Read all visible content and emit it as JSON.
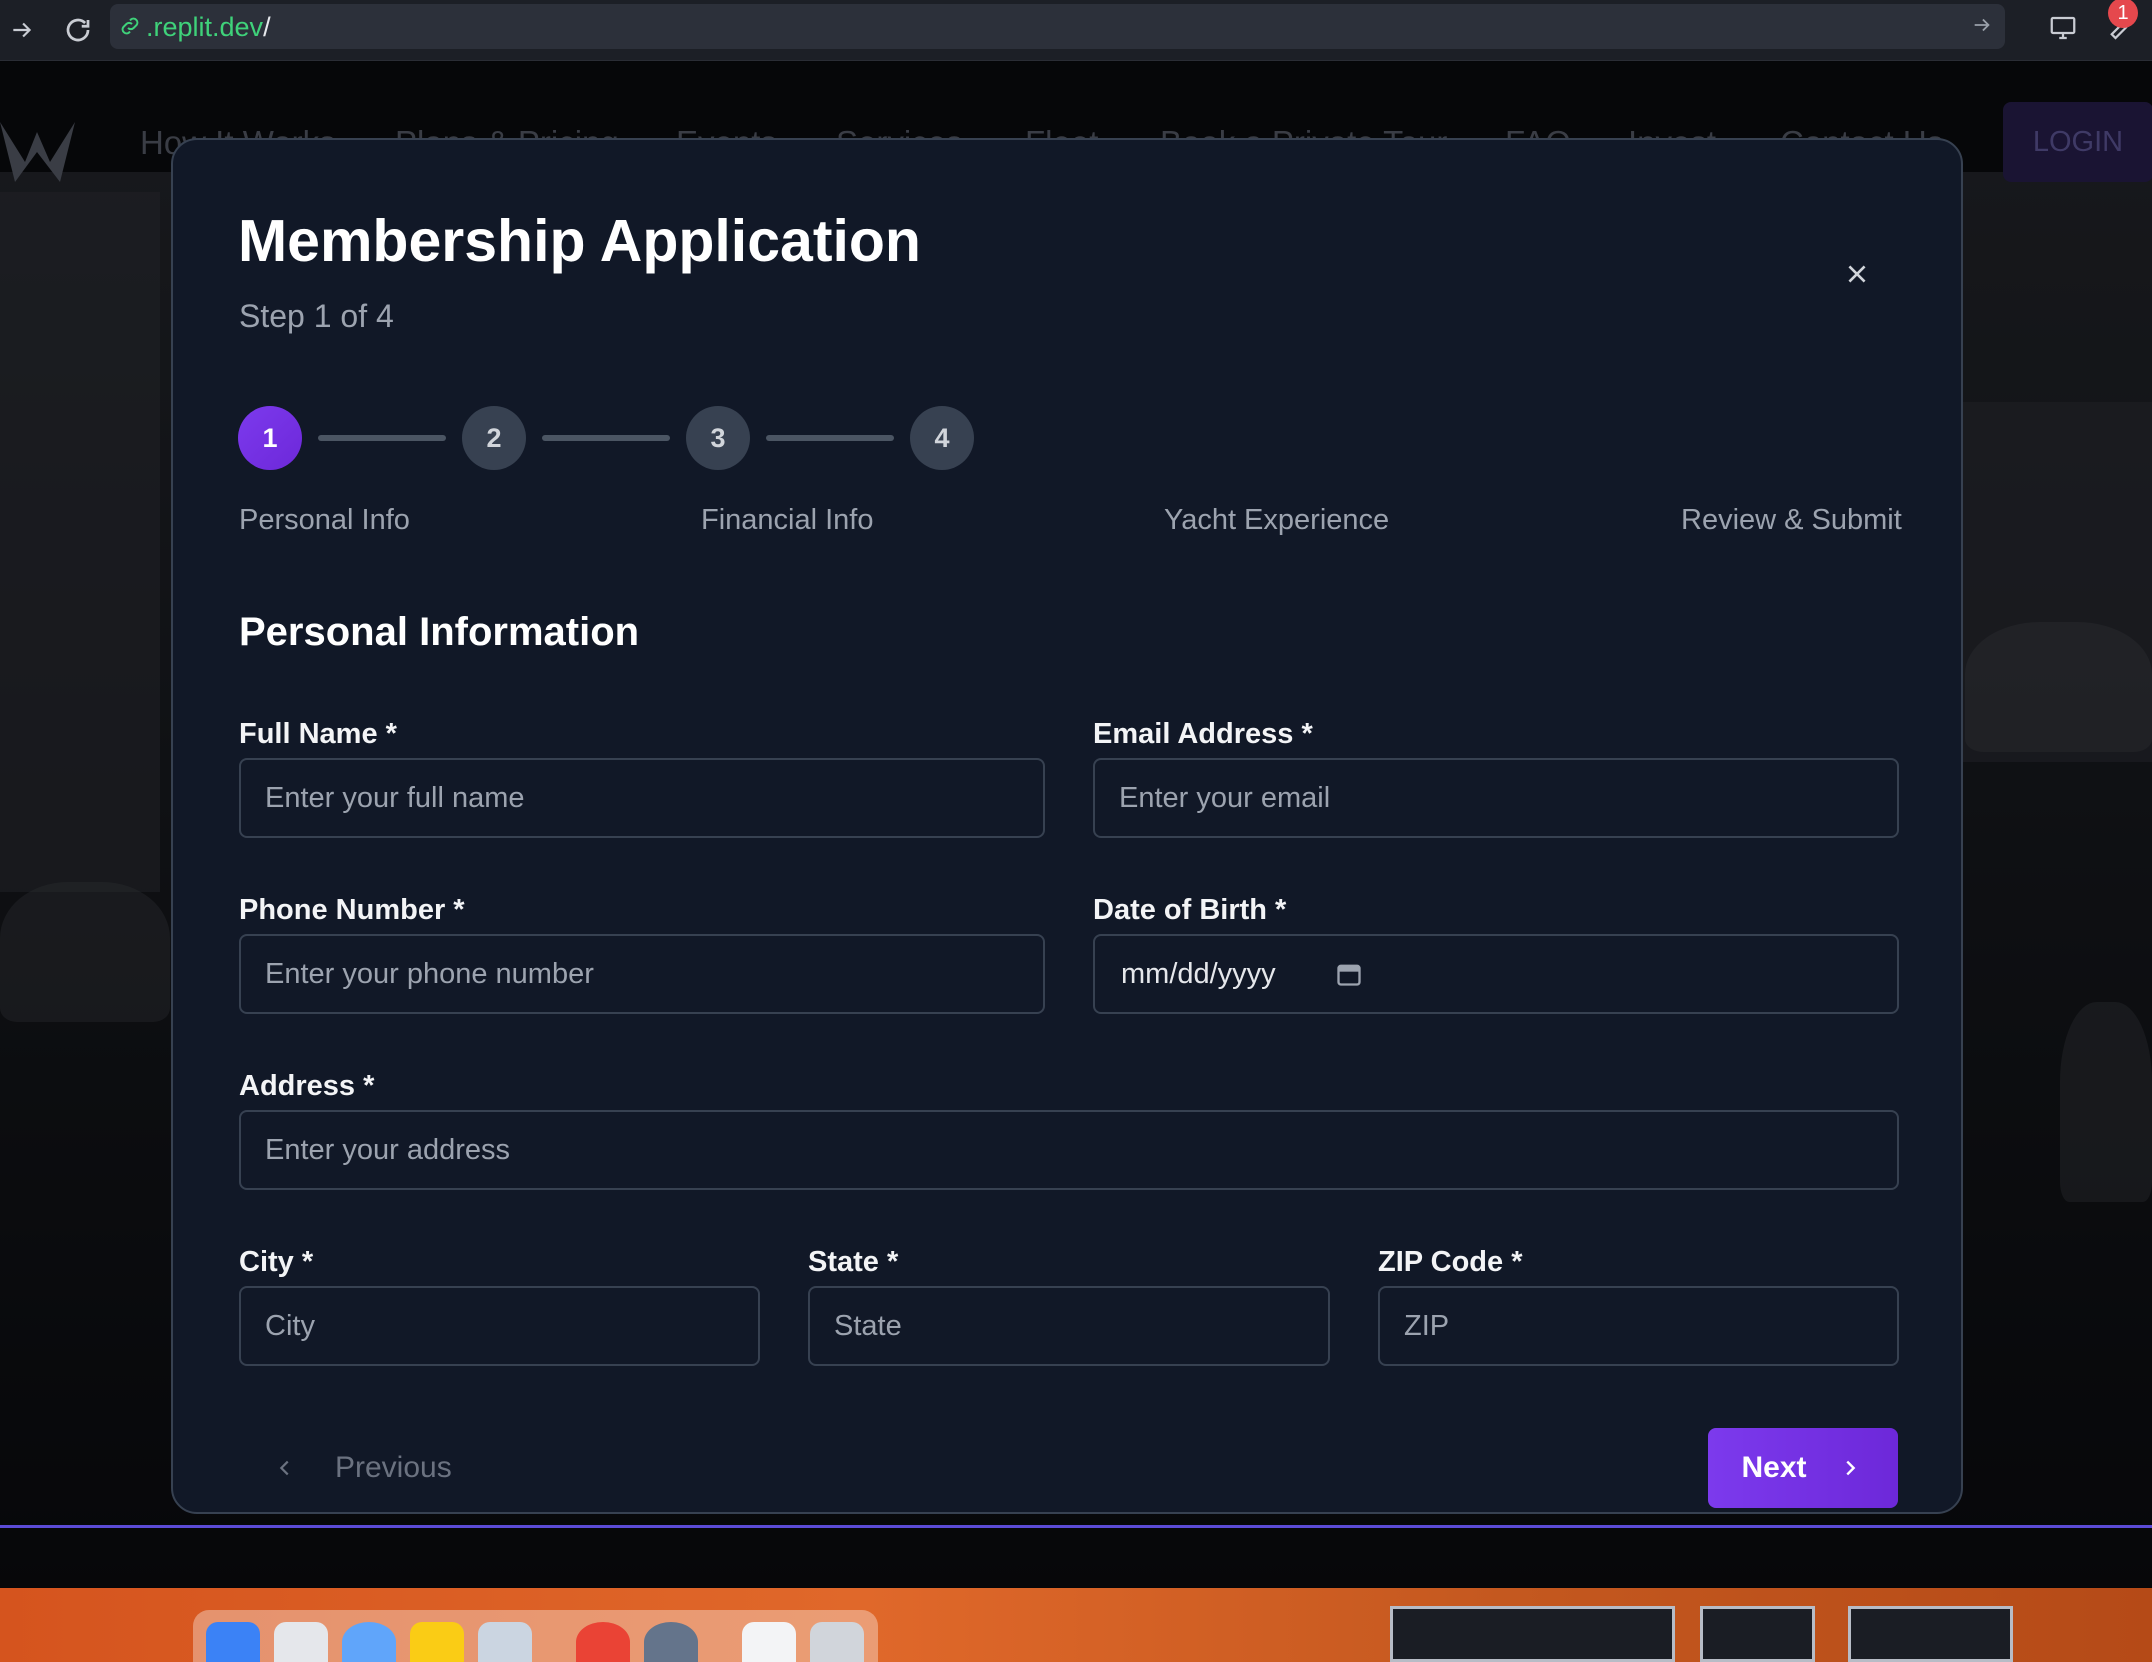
{
  "browser": {
    "url_prefix": ".replit.dev",
    "url_suffix": "/",
    "notification_count": "1"
  },
  "site": {
    "nav_items": [
      "How It Works",
      "Plans & Pricing",
      "Events",
      "Services",
      "Fleet",
      "Book a Private Tour",
      "FAQ",
      "Invest",
      "Contact Us"
    ],
    "login_label": "LOGIN"
  },
  "modal": {
    "title": "Membership Application",
    "step_text": "Step 1 of 4",
    "steps": [
      {
        "number": "1",
        "label": "Personal Info",
        "active": true
      },
      {
        "number": "2",
        "label": "Financial Info",
        "active": false
      },
      {
        "number": "3",
        "label": "Yacht Experience",
        "active": false
      },
      {
        "number": "4",
        "label": "Review & Submit",
        "active": false
      }
    ],
    "section_title": "Personal Information",
    "fields": {
      "full_name": {
        "label": "Full Name *",
        "placeholder": "Enter your full name"
      },
      "email": {
        "label": "Email Address *",
        "placeholder": "Enter your email"
      },
      "phone": {
        "label": "Phone Number *",
        "placeholder": "Enter your phone number"
      },
      "dob": {
        "label": "Date of Birth *",
        "value": "mm/dd/yyyy"
      },
      "address": {
        "label": "Address *",
        "placeholder": "Enter your address"
      },
      "city": {
        "label": "City *",
        "placeholder": "City"
      },
      "state": {
        "label": "State *",
        "placeholder": "State"
      },
      "zip": {
        "label": "ZIP Code *",
        "placeholder": "ZIP"
      }
    },
    "prev_label": "Previous",
    "next_label": "Next"
  },
  "colors": {
    "accent": "#7c3aed",
    "modal_bg": "#111827",
    "input_border": "#374151",
    "url_green": "#3fd27a"
  }
}
